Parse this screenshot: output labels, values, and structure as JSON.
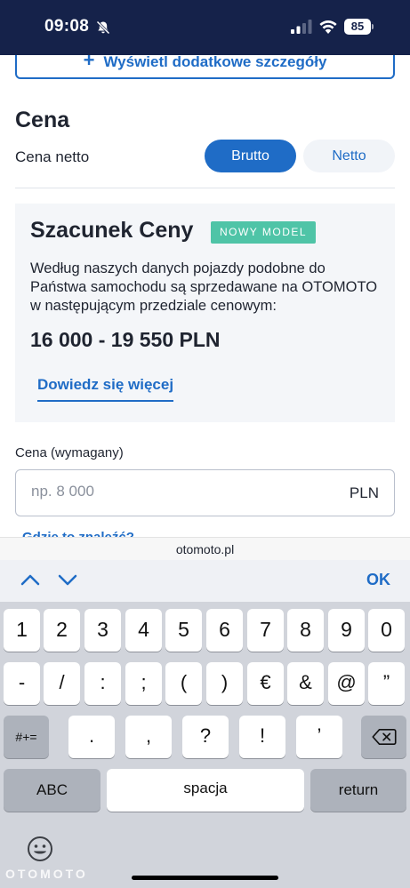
{
  "status_bar": {
    "time": "09:08",
    "battery": "85"
  },
  "form": {
    "details_button": "Wyświetl dodatkowe szczegóły",
    "section_title": "Cena",
    "net_label": "Cena netto",
    "toggle_gross": "Brutto",
    "toggle_net": "Netto",
    "estimate": {
      "title": "Szacunek Ceny",
      "badge": "NOWY MODEL",
      "description": "Według naszych danych pojazdy podobne do Państwa samochodu są sprzedawane na OTOMOTO w następującym przedziale cenowym:",
      "range": "16 000 - 19 550 PLN",
      "link": "Dowiedz się więcej"
    },
    "price_label": "Cena (wymagany)",
    "price_placeholder": "np. 8 000",
    "price_value": "",
    "price_unit": "PLN",
    "partial_link": "Gdzie to znaleźć?"
  },
  "browser": {
    "url": "otomoto.pl"
  },
  "accessory": {
    "ok": "OK"
  },
  "keyboard": {
    "row1": [
      "1",
      "2",
      "3",
      "4",
      "5",
      "6",
      "7",
      "8",
      "9",
      "0"
    ],
    "row2": [
      "-",
      "/",
      ":",
      ";",
      "(",
      ")",
      "€",
      "&",
      "@",
      "”"
    ],
    "row3_left": "#+=",
    "row3": [
      ".",
      ",",
      "?",
      "!",
      "’"
    ],
    "abc": "ABC",
    "space": "spacja",
    "return": "return"
  },
  "watermark": "OTOMOTO",
  "colors": {
    "status_bar": "#15224a",
    "accent": "#1f6cc6",
    "badge": "#4fc4a7",
    "card": "#f4f6f9",
    "keyboard": "#d1d4db"
  }
}
